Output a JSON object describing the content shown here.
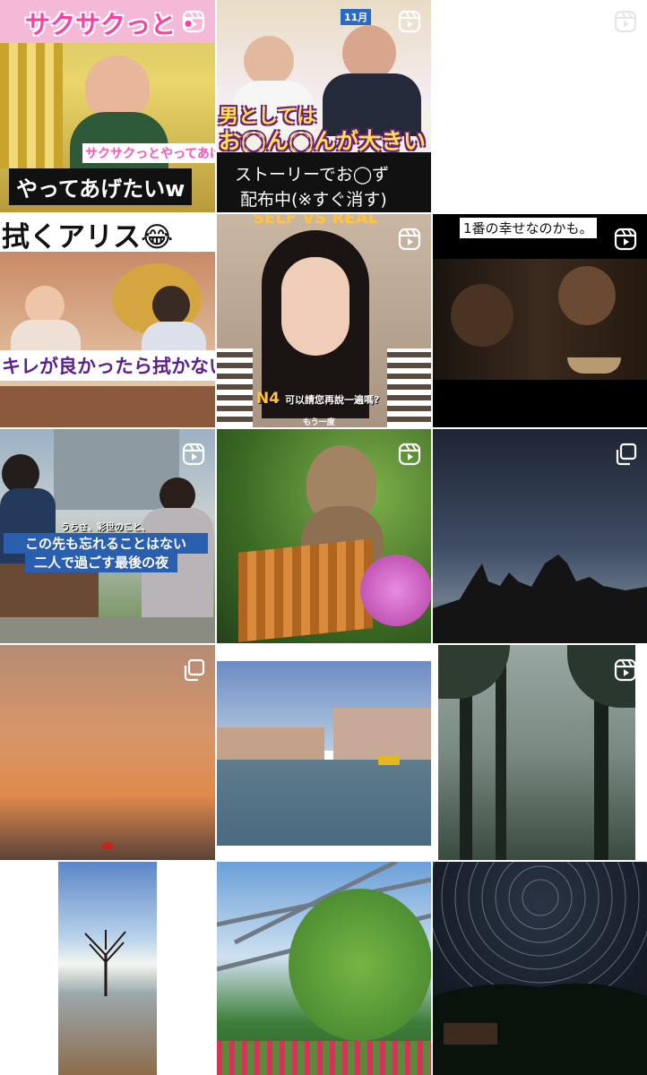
{
  "grid": {
    "tiles": [
      {
        "kind": "reel",
        "captions": {
          "title": "サクサクっと・",
          "sub": "サクサクっとやってあげたい",
          "bottom": "やってあげたいw"
        }
      },
      {
        "kind": "reel",
        "captions": {
          "top_right": "11月",
          "overlay1": "男としては",
          "overlay2": "お◯ん◯んが大きい",
          "bottom1": "ストーリーでお◯ず",
          "bottom2": "配布中(※すぐ消す)"
        }
      },
      {
        "kind": "reel",
        "captions": {}
      },
      {
        "kind": "reel",
        "captions": {
          "top": "拭くアリス😂",
          "bottom": "キレが良かったら拭かない"
        }
      },
      {
        "kind": "reel",
        "captions": {
          "top": "SELF VS REAL",
          "sub1": "N4",
          "sub2": "可以請您再說一遍嗎?",
          "sub3": "もう一度"
        }
      },
      {
        "kind": "reel",
        "captions": {
          "top": "1番の幸せなのかも。"
        }
      },
      {
        "kind": "reel",
        "captions": {
          "line0": "うちさ、彩世のこと、",
          "line1": "この先も忘れることはない",
          "line2": "二人で過ごす最後の夜"
        }
      },
      {
        "kind": "reel",
        "captions": {}
      },
      {
        "kind": "carousel",
        "captions": {}
      },
      {
        "kind": "carousel",
        "captions": {}
      },
      {
        "kind": "image",
        "captions": {}
      },
      {
        "kind": "reel",
        "captions": {}
      },
      {
        "kind": "reel",
        "captions": {}
      },
      {
        "kind": "image",
        "captions": {}
      },
      {
        "kind": "image",
        "captions": {}
      }
    ]
  },
  "icons": {
    "reel": "reels-icon",
    "carousel": "carousel-icon"
  }
}
